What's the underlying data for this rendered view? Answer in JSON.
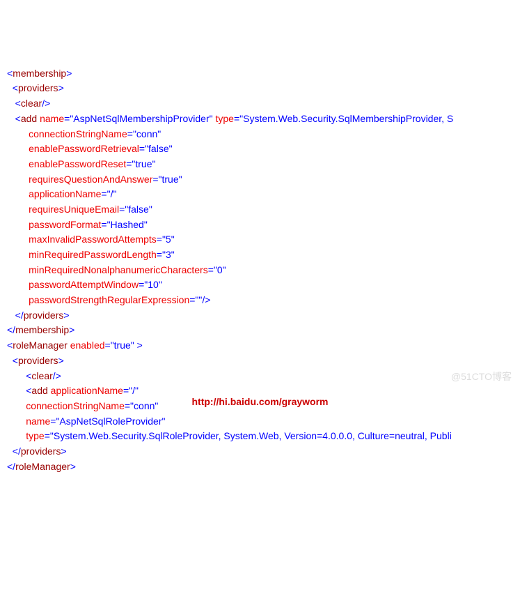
{
  "tags": {
    "membership": "membership",
    "providers": "providers",
    "clear": "clear",
    "add": "add",
    "roleManager": "roleManager"
  },
  "attrs": {
    "name": "name",
    "type": "type",
    "connectionStringName": "connectionStringName",
    "enablePasswordRetrieval": "enablePasswordRetrieval",
    "enablePasswordReset": "enablePasswordReset",
    "requiresQuestionAndAnswer": "requiresQuestionAndAnswer",
    "applicationName": "applicationName",
    "requiresUniqueEmail": "requiresUniqueEmail",
    "passwordFormat": "passwordFormat",
    "maxInvalidPasswordAttempts": "maxInvalidPasswordAttempts",
    "minRequiredPasswordLength": "minRequiredPasswordLength",
    "minRequiredNonalphanumericCharacters": "minRequiredNonalphanumericCharacters",
    "passwordAttemptWindow": "passwordAttemptWindow",
    "passwordStrengthRegularExpression": "passwordStrengthRegularExpression",
    "enabled": "enabled"
  },
  "vals": {
    "mem_name": "AspNetSqlMembershipProvider",
    "mem_type": "System.Web.Security.SqlMembershipProvider, S",
    "conn": "conn",
    "false": "false",
    "true": "true",
    "slash": "/",
    "hashed": "Hashed",
    "five": "5",
    "three": "3",
    "zero": "0",
    "ten": "10",
    "empty": "",
    "role_name": "AspNetSqlRoleProvider",
    "role_type": "System.Web.Security.SqlRoleProvider, System.Web, Version=4.0.0.0, Culture=neutral, Publi"
  },
  "watermark": "@51CTO博客",
  "footer_url": "http://hi.baidu.com/grayworm"
}
